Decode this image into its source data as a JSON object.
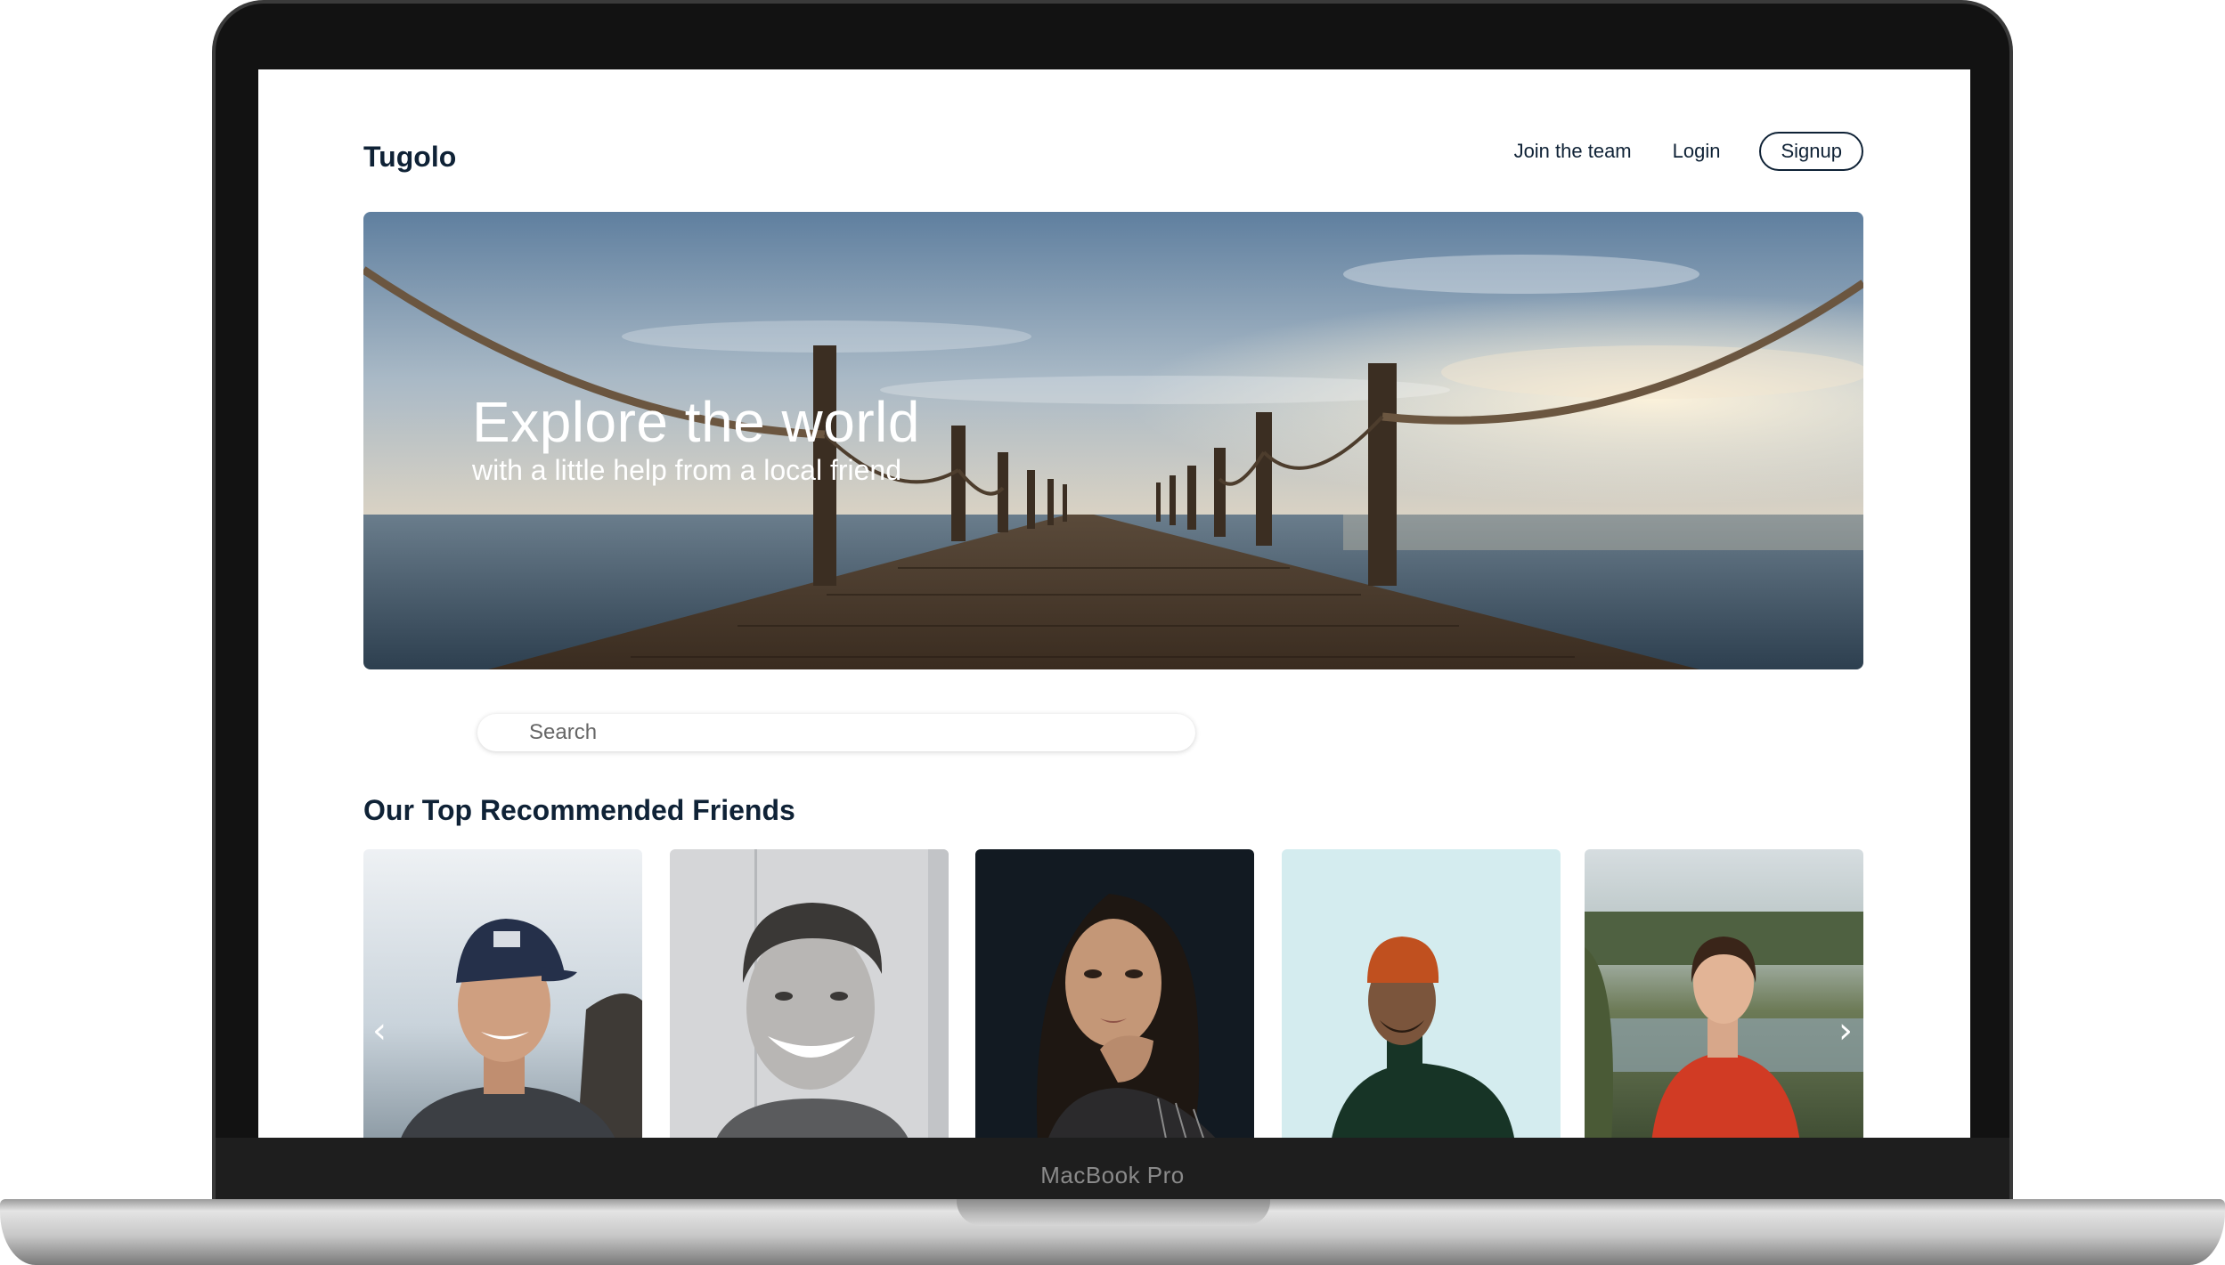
{
  "device": {
    "label": "MacBook Pro"
  },
  "header": {
    "logo": "Tugolo",
    "nav": {
      "join_team": "Join the team",
      "login": "Login",
      "signup": "Signup"
    }
  },
  "hero": {
    "title": "Explore the world",
    "subtitle": "with a little help from a local friend"
  },
  "search": {
    "placeholder": "Search"
  },
  "friends": {
    "title": "Our Top Recommended Friends",
    "prev_icon": "chevron-left-icon",
    "next_icon": "chevron-right-icon"
  },
  "colors": {
    "brand_navy": "#0f2236"
  }
}
